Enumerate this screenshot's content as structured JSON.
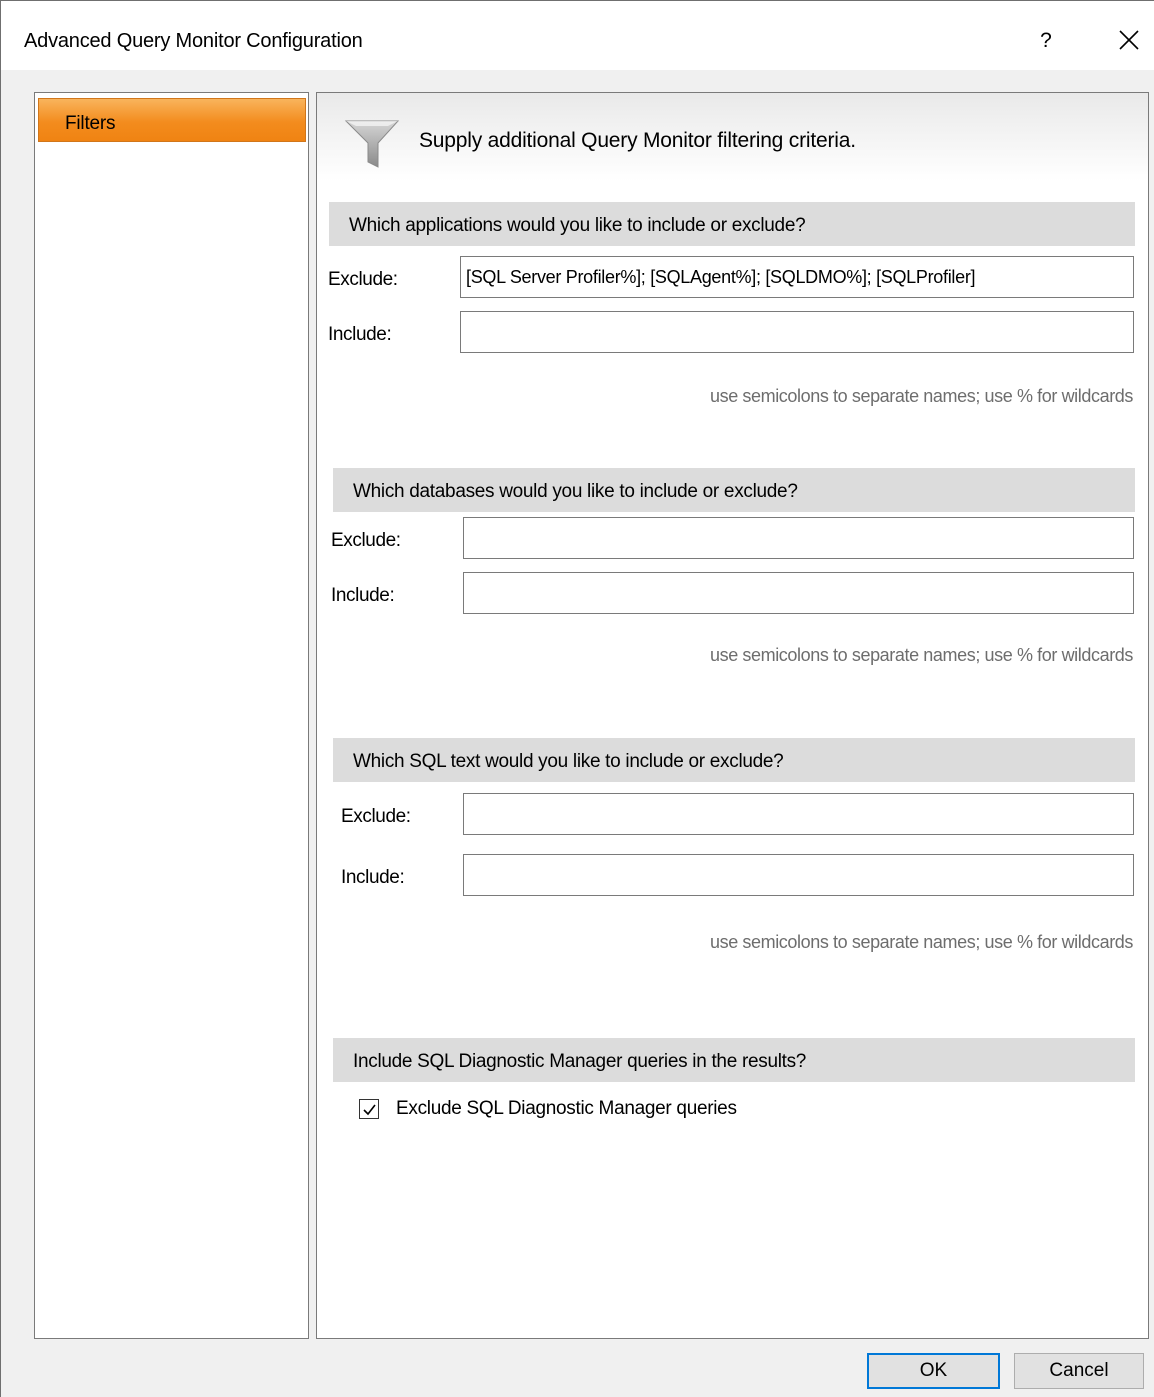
{
  "window": {
    "title": "Advanced Query Monitor Configuration",
    "help_label": "?",
    "close_icon": "close-icon"
  },
  "nav": {
    "items": [
      {
        "label": "Filters",
        "selected": true
      }
    ]
  },
  "header": {
    "icon": "funnel-icon",
    "text": "Supply additional Query Monitor filtering criteria."
  },
  "sections": {
    "applications": {
      "title": "Which applications would you like to include or exclude?",
      "exclude_label": "Exclude:",
      "exclude_value": "[SQL Server Profiler%]; [SQLAgent%]; [SQLDMO%]; [SQLProfiler]",
      "include_label": "Include:",
      "include_value": "",
      "hint": "use semicolons to separate names; use % for wildcards"
    },
    "databases": {
      "title": "Which databases would you like to include or exclude?",
      "exclude_label": "Exclude:",
      "exclude_value": "",
      "include_label": "Include:",
      "include_value": "",
      "hint": "use semicolons to separate names; use % for wildcards"
    },
    "sql_text": {
      "title": "Which SQL text would you like to include or exclude?",
      "exclude_label": "Exclude:",
      "exclude_value": "",
      "include_label": "Include:",
      "include_value": "",
      "hint": "use semicolons to separate names; use % for wildcards"
    },
    "sqldm": {
      "title": "Include SQL Diagnostic Manager queries in the results?",
      "checkbox_label": "Exclude SQL Diagnostic Manager queries",
      "checked": true
    }
  },
  "buttons": {
    "ok_label": "OK",
    "cancel_label": "Cancel"
  },
  "colors": {
    "nav_selected": "#f38c1e",
    "section_bar": "#dcdcdc",
    "ok_border": "#0078d7"
  }
}
